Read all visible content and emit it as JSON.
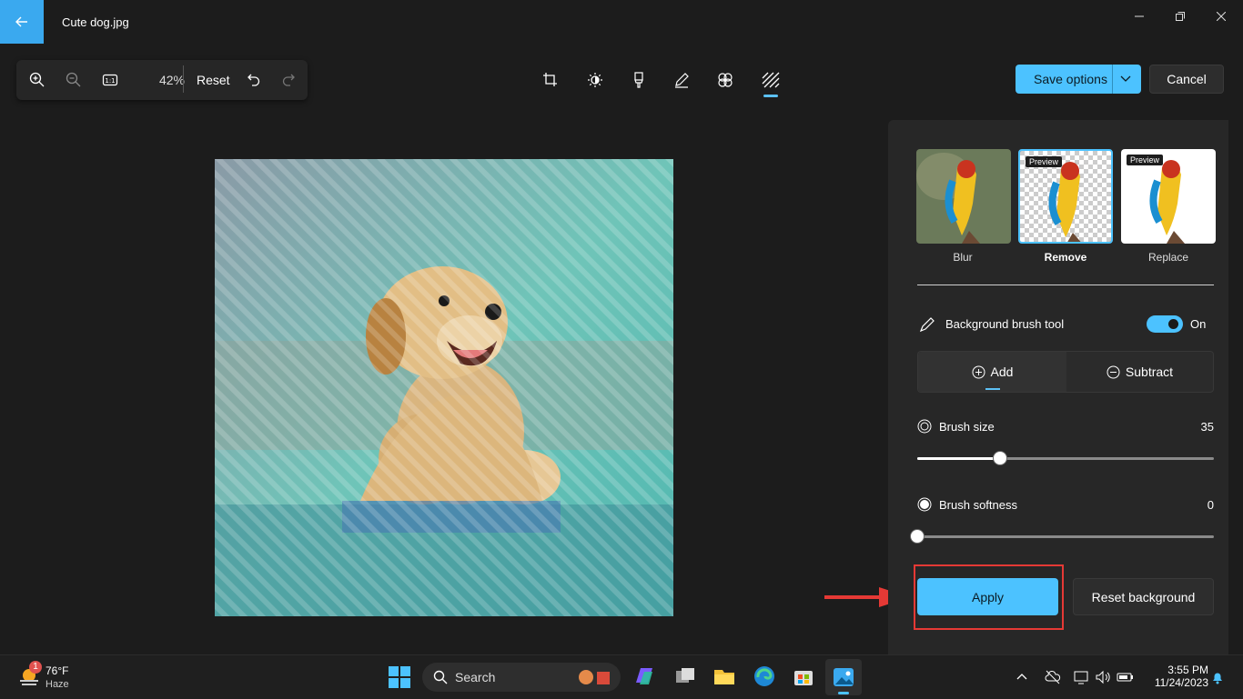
{
  "window": {
    "title": "Cute dog.jpg"
  },
  "toolbar": {
    "zoom": "42%",
    "reset_label": "Reset"
  },
  "actions": {
    "save_label": "Save options",
    "cancel_label": "Cancel"
  },
  "panel": {
    "options": [
      {
        "label": "Blur",
        "preview": ""
      },
      {
        "label": "Remove",
        "preview": "Preview"
      },
      {
        "label": "Replace",
        "preview": "Preview"
      }
    ],
    "brush_tool_label": "Background brush tool",
    "toggle_state": "On",
    "toggle_on": true,
    "add_label": "Add",
    "subtract_label": "Subtract",
    "brush_size_label": "Brush size",
    "brush_size_value": "35",
    "brush_size_fraction": 0.28,
    "brush_softness_label": "Brush softness",
    "brush_softness_value": "0",
    "brush_softness_fraction": 0,
    "apply_label": "Apply",
    "reset_bg_label": "Reset background"
  },
  "taskbar": {
    "temperature": "76°F",
    "weather": "Haze",
    "weather_badge": "1",
    "search_label": "Search",
    "time": "3:55 PM",
    "date": "11/24/2023"
  },
  "colors": {
    "accent": "#4cc2ff",
    "highlight_box": "#e53935",
    "arrow": "#e53935"
  }
}
